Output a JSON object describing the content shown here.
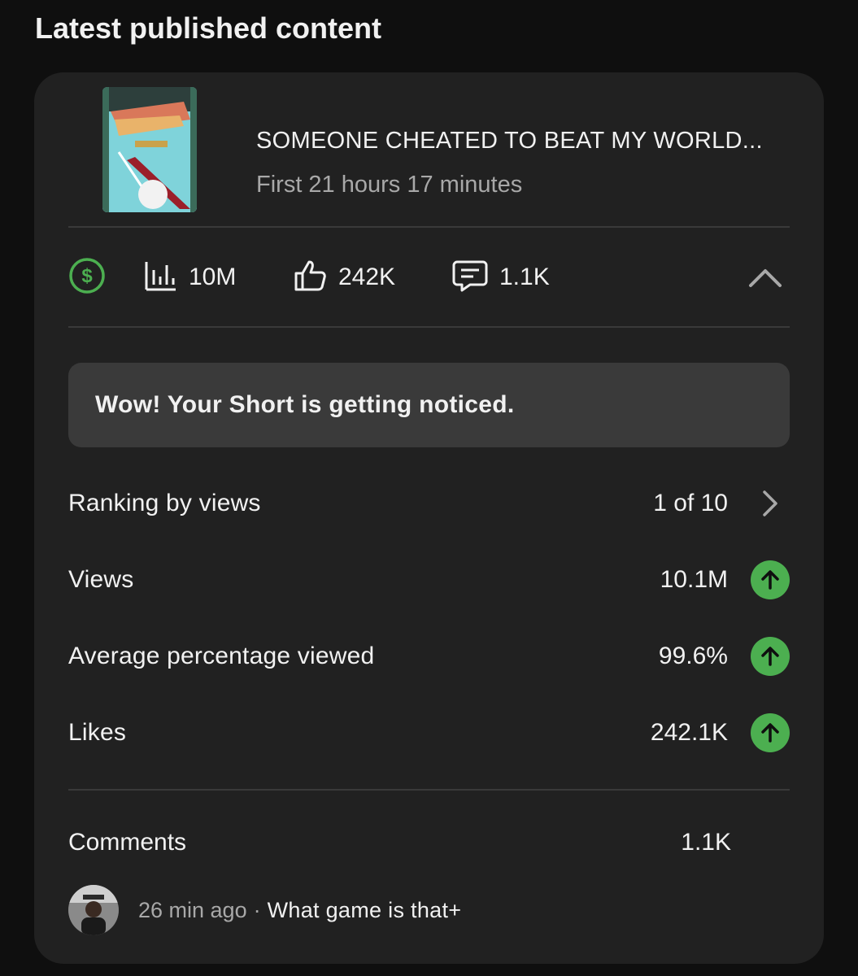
{
  "section_title": "Latest published content",
  "video": {
    "title": "SOMEONE CHEATED TO BEAT MY WORLD...",
    "subtitle": "First 21 hours 17 minutes"
  },
  "stats": {
    "monetization_icon": "dollar-circle-icon",
    "views": "10M",
    "likes": "242K",
    "comments": "1.1K"
  },
  "notice": "Wow! Your Short is getting noticed.",
  "metrics": [
    {
      "label": "Ranking by views",
      "value": "1 of 10",
      "indicator": "chevron-right-icon"
    },
    {
      "label": "Views",
      "value": "10.1M",
      "indicator": "arrow-up-icon"
    },
    {
      "label": "Average percentage viewed",
      "value": "99.6%",
      "indicator": "arrow-up-icon"
    },
    {
      "label": "Likes",
      "value": "242.1K",
      "indicator": "arrow-up-icon"
    }
  ],
  "comments": {
    "label": "Comments",
    "count": "1.1K",
    "latest": {
      "time": "26 min ago",
      "separator": "·",
      "text": "What game is that+"
    }
  },
  "colors": {
    "background": "#0f0f0f",
    "card": "#212121",
    "notice_bg": "#3a3a3a",
    "accent_green": "#4caf50",
    "secondary_text": "#a8a8a8"
  }
}
